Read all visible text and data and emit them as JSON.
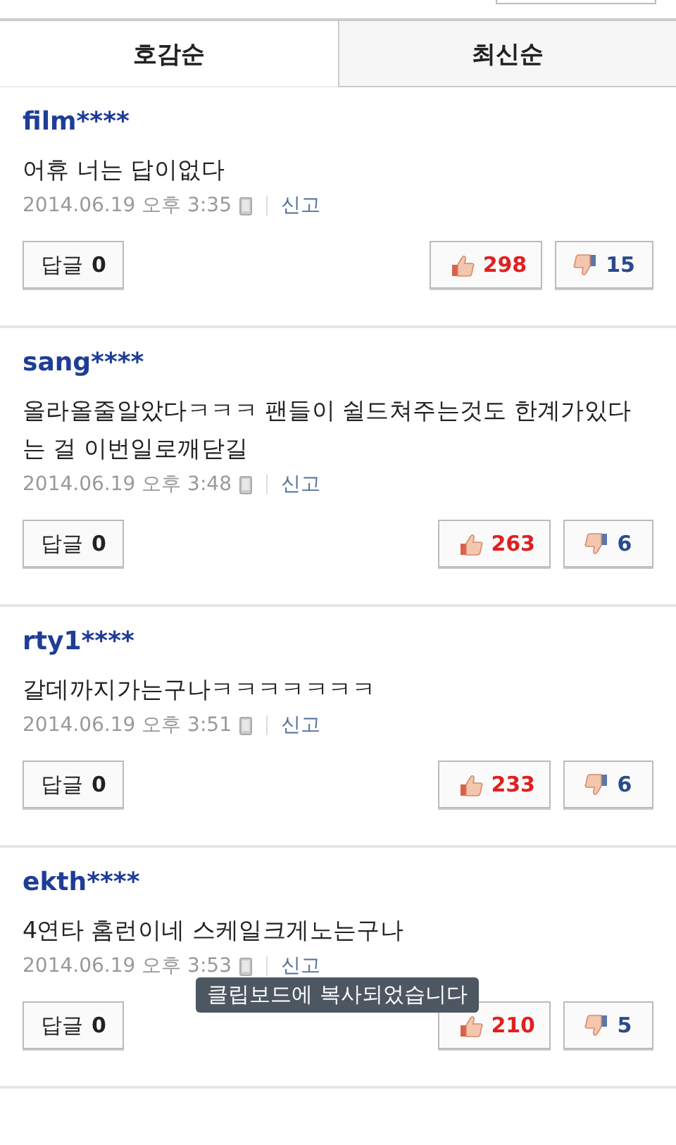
{
  "tabs": [
    {
      "label": "호감순",
      "selected": true
    },
    {
      "label": "최신순",
      "selected": false
    }
  ],
  "comments": [
    {
      "user": "film****",
      "text": "어휴 너는 답이없다",
      "time": "2014.06.19 오후 3:35",
      "report": "신고",
      "reply_label": "답글",
      "reply_count": "0",
      "likes": "298",
      "dislikes": "15"
    },
    {
      "user": "sang****",
      "text": "올라올줄알았다ㅋㅋㅋ 팬들이 쉴드쳐주는것도 한계가있다는 걸 이번일로깨닫길",
      "time": "2014.06.19 오후 3:48",
      "report": "신고",
      "reply_label": "답글",
      "reply_count": "0",
      "likes": "263",
      "dislikes": "6"
    },
    {
      "user": "rty1****",
      "text": "갈데까지가는구나ㅋㅋㅋㅋㅋㅋㅋ",
      "time": "2014.06.19 오후 3:51",
      "report": "신고",
      "reply_label": "답글",
      "reply_count": "0",
      "likes": "233",
      "dislikes": "6"
    },
    {
      "user": "ekth****",
      "text": "4연타 홈런이네 스케일크게노는구나",
      "time": "2014.06.19 오후 3:53",
      "report": "신고",
      "reply_label": "답글",
      "reply_count": "0",
      "likes": "210",
      "dislikes": "5"
    }
  ],
  "toast": "클립보드에 복사되었습니다"
}
